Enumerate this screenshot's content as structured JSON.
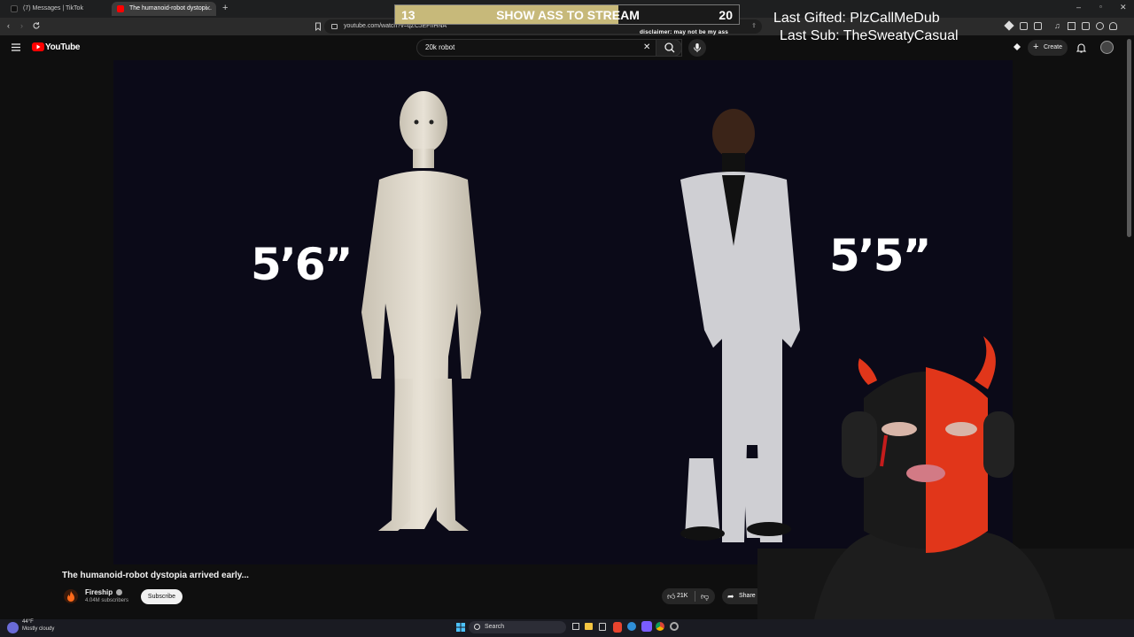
{
  "browser": {
    "tabs": [
      {
        "label": "(7) Messages | TikTok"
      },
      {
        "label": "The humanoid-robot dystopi..."
      }
    ],
    "url": "youtube.com/watch?v=qZCJEFnHNA"
  },
  "youtube": {
    "logo_text": "YouTube",
    "search_value": "20k robot",
    "create_label": "Create"
  },
  "video": {
    "left_height": "5’6”",
    "right_height": "5’5”",
    "title": "The humanoid-robot dystopia arrived early...",
    "channel": "Fireship",
    "subscribers": "4.04M subscribers",
    "subscribe_label": "Subscribe",
    "likes": "21K",
    "share_label": "Share"
  },
  "stream_overlay": {
    "left_count": "13",
    "banner_text": "SHOW ASS TO STREAM",
    "right_count": "20",
    "progress": 0.65,
    "disclaimer": "disclaimer: may not be my ass",
    "last_gifted": "Last Gifted: PlzCallMeDub",
    "last_sub": "Last Sub: TheSweatyCasual"
  },
  "taskbar": {
    "temperature": "44°F",
    "weather": "Mostly cloudy",
    "search_label": "Search"
  },
  "colors": {
    "youtube_red": "#ff0000",
    "banner_fill": "#c7b97a",
    "video_bg": "#0b0a18"
  }
}
